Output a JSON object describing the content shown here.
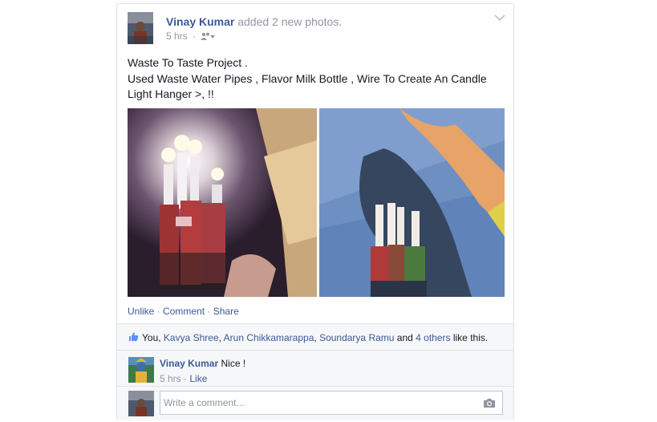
{
  "post": {
    "author": "Vinay Kumar",
    "action": " added 2 new photos.",
    "time": "5 hrs",
    "text_line1": "Waste To Taste Project .",
    "text_line2": "Used Waste Water Pipes , Flavor Milk Bottle , Wire To Create An Candle Light Hanger >, !!",
    "audience_icon": "friends-icon"
  },
  "actions": {
    "unlike": "Unlike",
    "comment": "Comment",
    "share": "Share",
    "sep": " · "
  },
  "likes": {
    "prefix": "You, ",
    "names": [
      "Kavya Shree",
      "Arun Chikkamarappa",
      "Soundarya Ramu"
    ],
    "sep1": ", ",
    "sep2": ", ",
    "and": " and ",
    "others": "4 others",
    "suffix": " like this."
  },
  "comment": {
    "author": "Vinay Kumar",
    "text": " Nice !",
    "time": "5 hrs",
    "like": "Like",
    "sep": " · "
  },
  "composer": {
    "placeholder": "Write a comment..."
  },
  "colors": {
    "link": "#3b5998",
    "muted": "#9197a3",
    "panel": "#f6f7f9"
  }
}
